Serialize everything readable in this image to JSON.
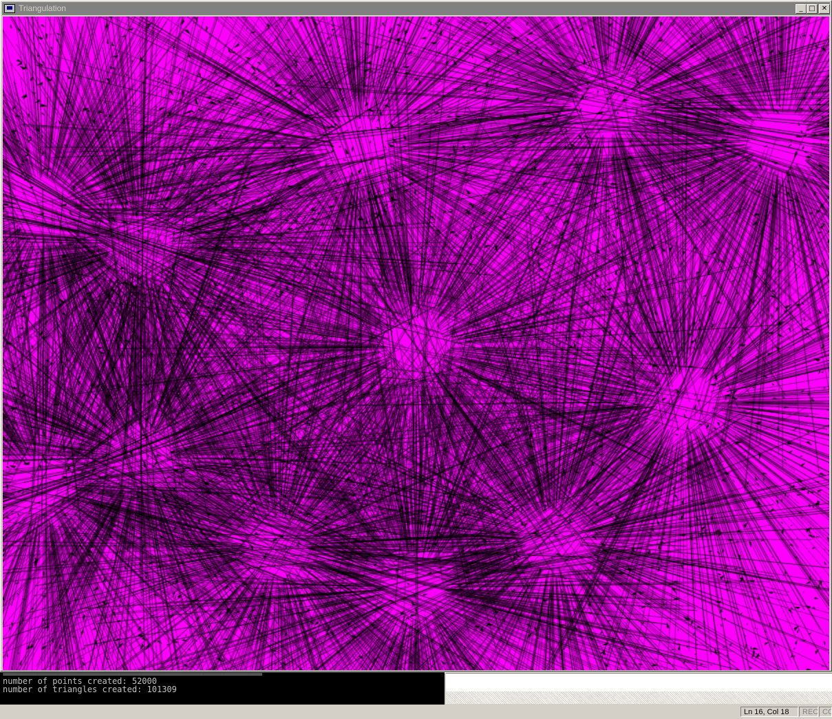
{
  "window": {
    "title": "Triangulation",
    "app_icon": "window-app-icon",
    "controls": {
      "minimize_glyph": "_",
      "maximize_glyph": "□",
      "close_glyph": "✕"
    }
  },
  "canvas": {
    "background_color": "#ff00ff",
    "edge_color": "#000000",
    "description_of_content": null
  },
  "console": {
    "divider": "===========================================================================",
    "lines": [
      "number of points created: 52000",
      "number of triangles created: 101309"
    ]
  },
  "statusbar": {
    "position": "Ln 16, Col 18",
    "rec": "REC",
    "col": "COL"
  }
}
